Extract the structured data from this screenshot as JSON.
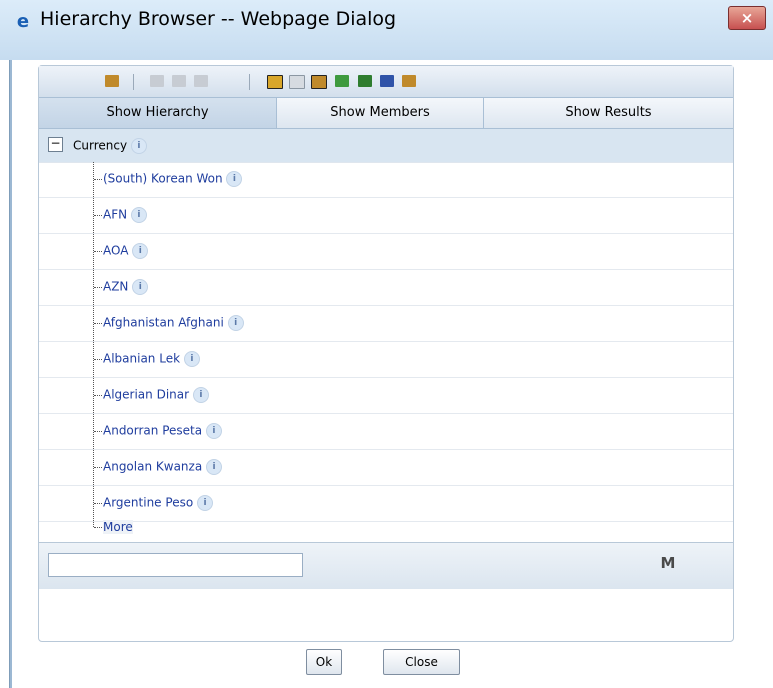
{
  "window": {
    "title": "Hierarchy Browser -- Webpage Dialog",
    "close_glyph": "×"
  },
  "toolbar": {
    "icons": [
      "find-hierarchy-icon",
      "expand-icon",
      "collapse-icon",
      "sort-icon",
      "collapse-all-icon",
      "expand-all-icon",
      "expand-branch-icon",
      "tree-view-icon",
      "org-chart-icon",
      "select-all-icon",
      "properties-icon"
    ]
  },
  "tabs": [
    {
      "label": "Show Hierarchy",
      "active": true
    },
    {
      "label": "Show Members",
      "active": false
    },
    {
      "label": "Show Results",
      "active": false
    }
  ],
  "tree": {
    "root": {
      "label": "Currency",
      "expand_glyph": "−"
    },
    "info_glyph": "i",
    "items": [
      "(South) Korean Won",
      "AFN",
      "AOA",
      "AZN",
      "Afghanistan Afghani",
      "Albanian Lek",
      "Algerian Dinar",
      "Andorran Peseta",
      "Angolan Kwanza",
      "Argentine Peso"
    ],
    "more": "More"
  },
  "search": {
    "value": "",
    "placeholder": "",
    "find_glyph": "M"
  },
  "buttons": {
    "ok": "Ok",
    "close": "Close"
  },
  "colors": {
    "accent": "#1f3d9e",
    "header": "#d8e5f1"
  }
}
